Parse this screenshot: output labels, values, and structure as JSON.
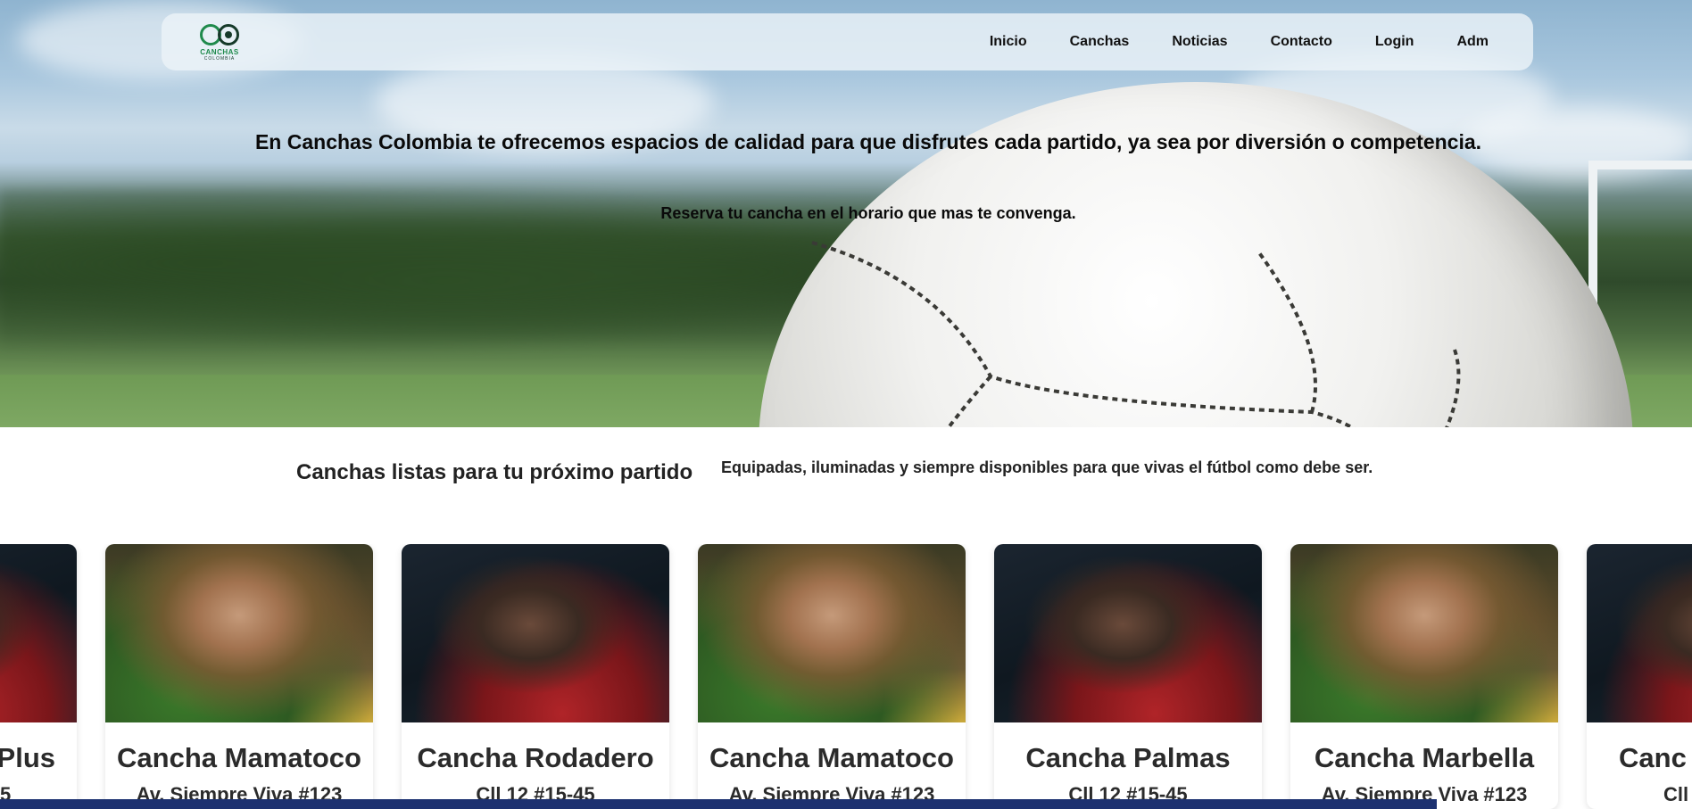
{
  "nav": {
    "logo_text": "CANCHAS",
    "logo_sub": "COLOMBIA",
    "links": [
      "Inicio",
      "Canchas",
      "Noticias",
      "Contacto",
      "Login",
      "Adm"
    ]
  },
  "hero": {
    "title": "En Canchas Colombia te ofrecemos espacios de calidad para que disfrutes cada partido, ya sea por diversión o competencia.",
    "subtitle": "Reserva tu cancha en el horario que mas te convenga."
  },
  "section": {
    "title": "Canchas listas para tu próximo partido",
    "description": "Equipadas, iluminadas y siempre disponibles para que vivas el fútbol como debe ser."
  },
  "cards": [
    {
      "name": "Plus",
      "address": "5",
      "image": "young-player-photo"
    },
    {
      "name": "Cancha Mamatoco",
      "address": "Av. Siempre Viva #123",
      "image": "old-player-photo"
    },
    {
      "name": "Cancha Rodadero",
      "address": "Cll 12 #15-45",
      "image": "young-player-photo"
    },
    {
      "name": "Cancha Mamatoco",
      "address": "Av. Siempre Viva #123",
      "image": "old-player-photo"
    },
    {
      "name": "Cancha Palmas",
      "address": "Cll 12 #15-45",
      "image": "young-player-photo"
    },
    {
      "name": "Cancha Marbella",
      "address": "Av. Siempre Viva #123",
      "image": "old-player-photo"
    },
    {
      "name": "Canc",
      "address": "Cll",
      "image": "young-player-photo"
    }
  ],
  "colors": {
    "brand_green": "#1f8a4c",
    "bottom_bar": "#1c3170"
  }
}
